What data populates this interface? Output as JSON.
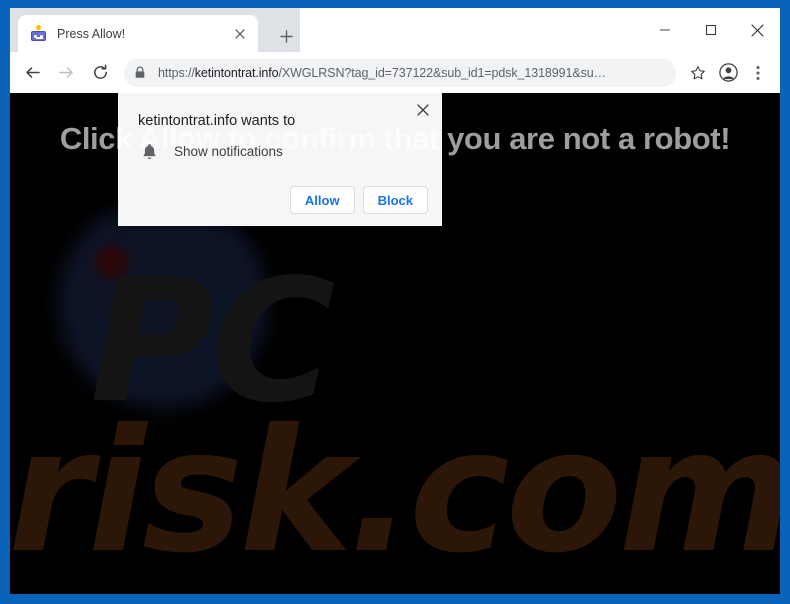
{
  "window": {
    "controls": {
      "minimize_label": "—",
      "maximize_label": "☐",
      "close_label": "×"
    }
  },
  "tabstrip": {
    "tab": {
      "title": "Press Allow!",
      "favicon_name": "robot-favicon",
      "close_label": "×"
    },
    "new_tab_label": "+"
  },
  "toolbar": {
    "back_label": "←",
    "forward_label": "→",
    "reload_label": "⟳",
    "lock_icon_name": "lock-icon",
    "url": {
      "scheme": "https://",
      "host": "ketintontrat.info",
      "path": "/XWGLRSN?tag_id=737122&sub_id1=pdsk_1318991&su…",
      "full": "https://ketintontrat.info/XWGLRSN?tag_id=737122&sub_id1=pdsk_1318991&su…"
    },
    "bookmark_label": "☆",
    "profile_label": "profile-avatar",
    "menu_label": "⋮"
  },
  "page": {
    "heading": "Click Allow to confirm that you are not a robot!",
    "background_color": "#000000",
    "heading_color": "#9e9e9e",
    "watermark": {
      "line1": "PC",
      "line2": "risk.com",
      "color_line1": "#141414",
      "color_line2": "#2b1608"
    }
  },
  "dialog": {
    "title": "ketintontrat.info wants to",
    "option_label": "Show notifications",
    "option_icon_name": "bell-icon",
    "close_label": "×",
    "allow_label": "Allow",
    "block_label": "Block",
    "accent_color": "#1a73e8"
  }
}
